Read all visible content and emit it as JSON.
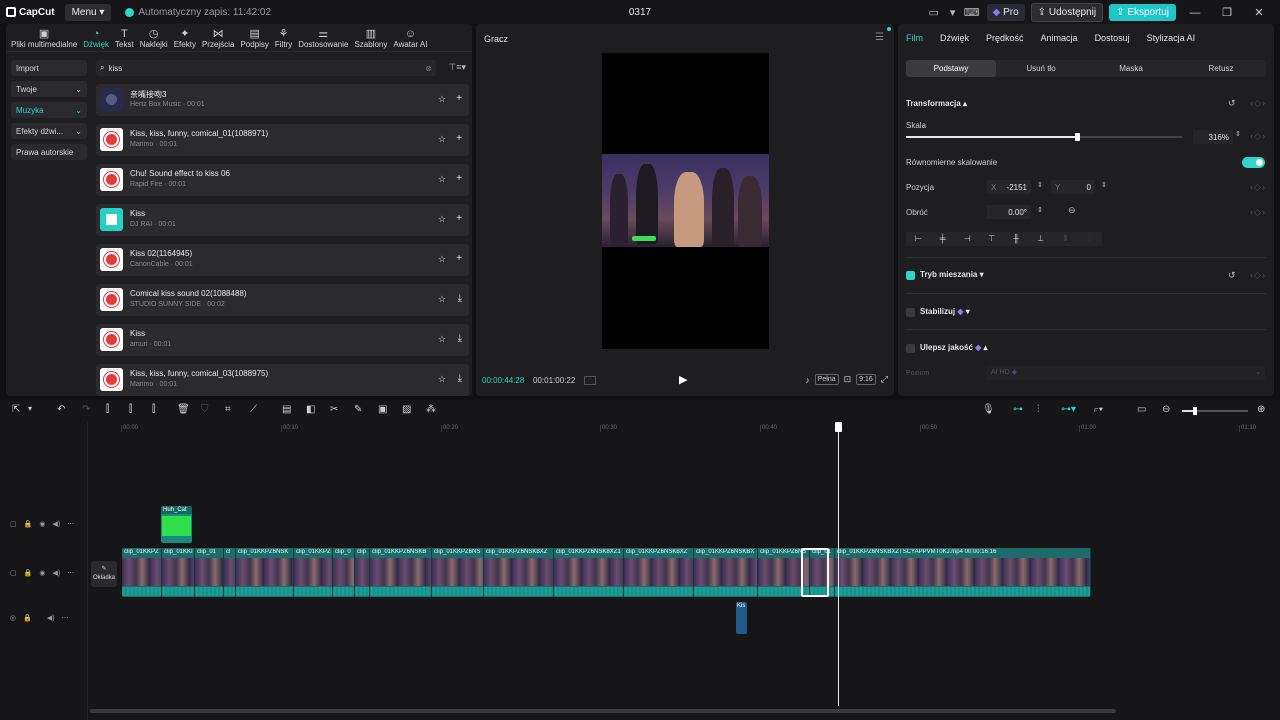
{
  "titlebar": {
    "app_name": "CapCut",
    "menu_label": "Menu",
    "autosave_text": "Automatyczny zapis: 11:42:02",
    "project_title": "0317",
    "pro_label": "Pro",
    "share_label": "Udostępnij",
    "export_label": "Eksportuj"
  },
  "media_tabs": [
    {
      "label": "Pliki multimedialne",
      "icon": "media-icon"
    },
    {
      "label": "Dźwięk",
      "icon": "audio-icon"
    },
    {
      "label": "Tekst",
      "icon": "text-icon"
    },
    {
      "label": "Naklejki",
      "icon": "sticker-icon"
    },
    {
      "label": "Efekty",
      "icon": "effects-icon"
    },
    {
      "label": "Przejścia",
      "icon": "transitions-icon"
    },
    {
      "label": "Podpisy",
      "icon": "captions-icon"
    },
    {
      "label": "Filtry",
      "icon": "filters-icon"
    },
    {
      "label": "Dostosowanie",
      "icon": "adjust-icon"
    },
    {
      "label": "Szablony",
      "icon": "templates-icon"
    },
    {
      "label": "Awatar AI",
      "icon": "avatar-icon"
    }
  ],
  "side_categories": [
    "Import",
    "Twoje",
    "Muzyka",
    "Efekty dźwi...",
    "Prawa autorskie"
  ],
  "search": {
    "value": "kiss"
  },
  "tracks": [
    {
      "title": "亲嘴接吻3",
      "sub": "Hertz Box Music · 00:01"
    },
    {
      "title": "Kiss, kiss, funny, comical_01(1088971)",
      "sub": "Marimo · 00:01"
    },
    {
      "title": "Chu! Sound effect to kiss 06",
      "sub": "Rapid Fire · 00:01"
    },
    {
      "title": "Kiss",
      "sub": "DJ RAI · 00:01"
    },
    {
      "title": "Kiss 02(1164945)",
      "sub": "CanonCable · 00:01"
    },
    {
      "title": "Comical kiss sound 02(1088488)",
      "sub": "STUDIO SUNNY SIDE · 00:02"
    },
    {
      "title": "Kiss",
      "sub": "amuri · 00:01"
    },
    {
      "title": "Kiss, kiss, funny, comical_03(1088975)",
      "sub": "Marimo · 00:01"
    }
  ],
  "player": {
    "title": "Gracz",
    "current_time": "00:00:44:28",
    "total_time": "00:01:00:22",
    "full_label": "Pełna",
    "ratio_label": "9:16"
  },
  "props": {
    "tabs": [
      "Film",
      "Dźwięk",
      "Prędkość",
      "Animacja",
      "Dostosuj",
      "Stylizacja AI"
    ],
    "sub_tabs": [
      "Podstawy",
      "Usuń tło",
      "Maska",
      "Retusz"
    ],
    "transform_title": "Transformacja",
    "scale_label": "Skala",
    "scale_value": "316%",
    "scale_fraction": 0.62,
    "uniform_label": "Równomierne skalowanie",
    "position_label": "Pozycja",
    "pos_x_prefix": "X",
    "pos_x": "-2151",
    "pos_y_prefix": "Y",
    "pos_y": "0",
    "rotate_label": "Obróć",
    "rotate_value": "0.00°",
    "blend_label": "Tryb mieszania",
    "stabilize_label": "Stabilizuj",
    "enhance_label": "Ulepsz jakość",
    "level_label": "Poziom",
    "level_value": "AI HD"
  },
  "timeline": {
    "ruler": [
      "00:00",
      "00:10",
      "00:20",
      "00:30",
      "00:40",
      "00:50",
      "01:00",
      "01:10"
    ],
    "cover_label": "Okładka",
    "overlay_name": "Huh_Cat",
    "segments": [
      "clip_01KKPZ",
      "clip_01KKI",
      "clip_01",
      "cl",
      "clip_01KKPZ6NSK",
      "clip_01KKPZ",
      "clip_0",
      "clip",
      "clip_01KKPZ6NSKB",
      "clip_01KKPZ6NS",
      "clip_01KKPZ6NSK8XZ",
      "clip_01KKPZ6NSK8XZ1",
      "clip_01KKPZ6NSK8XZ",
      "clip_01KKPZ6NSKBX",
      "clip_01KKPZ6NS",
      "clip_01",
      "clip_01KKPZ6NSKBXZTSCYAPPVMT0KJ.mp4   00:00:16:16"
    ],
    "audio_name": "Kis"
  }
}
